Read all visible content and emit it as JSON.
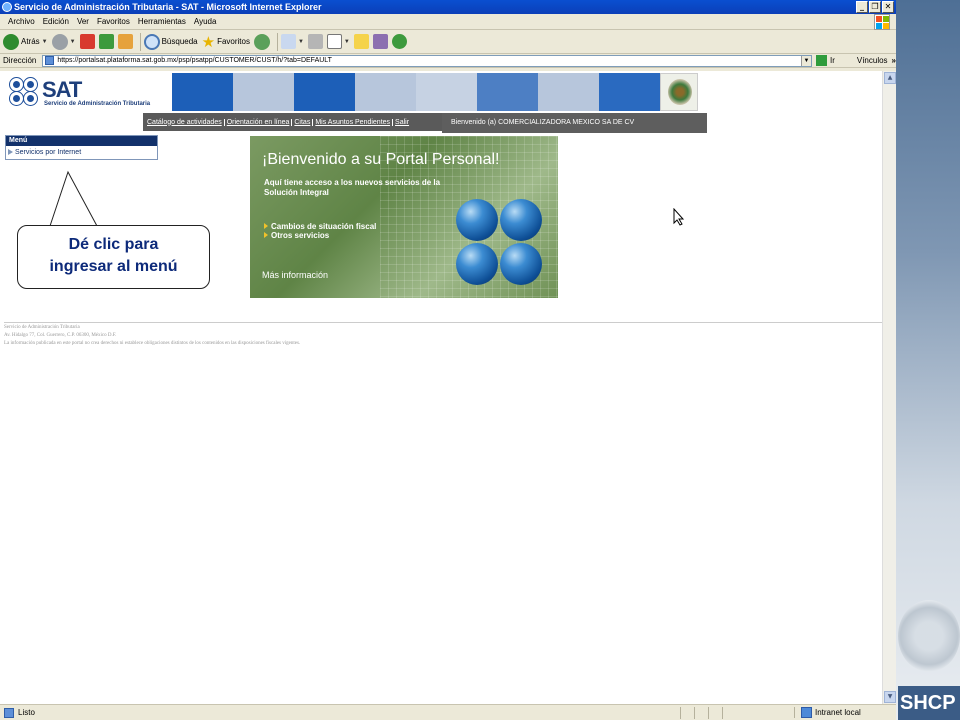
{
  "window": {
    "title": "Servicio de Administración Tributaria - SAT - Microsoft Internet Explorer"
  },
  "menubar": [
    "Archivo",
    "Edición",
    "Ver",
    "Favoritos",
    "Herramientas",
    "Ayuda"
  ],
  "toolbar": {
    "back_label": "Atrás",
    "search_label": "Búsqueda",
    "favorites_label": "Favoritos"
  },
  "address": {
    "label": "Dirección",
    "url": "https://portalsat.plataforma.sat.gob.mx/psp/psatpp/CUSTOMER/CUST/h/?tab=DEFAULT",
    "go_label": "Ir",
    "links_label": "Vínculos"
  },
  "header": {
    "logo_text": "SAT",
    "logo_subtitle": "Servicio de Administración Tributaria",
    "nav_links": [
      "Catálogo de actividades",
      "Orientación en línea",
      "Citas",
      "Mis Asuntos Pendientes",
      "Salir"
    ],
    "welcome": "Bienvenido (a)  COMERCIALIZADORA MEXICO SA DE CV"
  },
  "menu": {
    "title": "Menú",
    "items": [
      "Servicios por Internet"
    ]
  },
  "banner": {
    "title": "¡Bienvenido a su Portal Personal!",
    "text": "Aquí tiene acceso a los nuevos servicios de la Solución Integral",
    "items": [
      "Cambios de situación fiscal",
      "Otros servicios"
    ],
    "more_link": "Más información"
  },
  "footer": {
    "line1": "Servicio de Administración Tributaria",
    "line2": "Av. Hidalgo 77, Col. Guerrero, C.P. 06300, México D.F.",
    "line3": "La información publicada en este portal no crea derechos ni establece obligaciones distintos de los contenidos en las disposiciones fiscales vigentes."
  },
  "callout": {
    "line1": "Dé clic para",
    "line2": "ingresar al menú"
  },
  "statusbar": {
    "status": "Listo",
    "zone": "Intranet local"
  },
  "brand": {
    "side_label": "SHCP"
  },
  "colors": {
    "titlebar": "#0a4fd0",
    "sat_blue": "#1e3f7b",
    "menu_header": "#12316b",
    "nav_gray": "#5a5a5a",
    "callout_text": "#0d2a7a"
  }
}
